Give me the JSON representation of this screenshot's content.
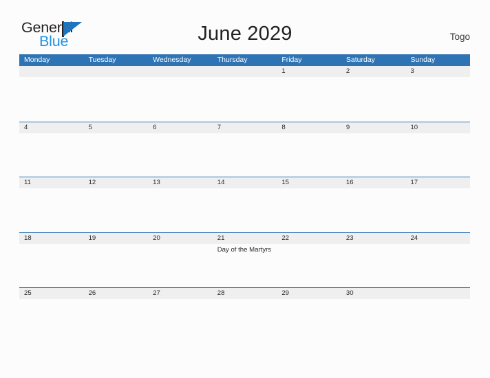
{
  "brand": {
    "name_part1": "General",
    "name_part2": "Blue",
    "flag_icon": "flag-triangle-icon",
    "colors": {
      "dark": "#231f20",
      "flag_blue": "#1f74bb",
      "text_blue": "#1f92e5"
    }
  },
  "header": {
    "title": "June 2029",
    "country": "Togo"
  },
  "calendar": {
    "accent_color": "#2e74b5",
    "band_color": "#efefef",
    "weekdays": [
      "Monday",
      "Tuesday",
      "Wednesday",
      "Thursday",
      "Friday",
      "Saturday",
      "Sunday"
    ],
    "weeks": [
      [
        {
          "day": "",
          "events": []
        },
        {
          "day": "",
          "events": []
        },
        {
          "day": "",
          "events": []
        },
        {
          "day": "",
          "events": []
        },
        {
          "day": "1",
          "events": []
        },
        {
          "day": "2",
          "events": []
        },
        {
          "day": "3",
          "events": []
        }
      ],
      [
        {
          "day": "4",
          "events": []
        },
        {
          "day": "5",
          "events": []
        },
        {
          "day": "6",
          "events": []
        },
        {
          "day": "7",
          "events": []
        },
        {
          "day": "8",
          "events": []
        },
        {
          "day": "9",
          "events": []
        },
        {
          "day": "10",
          "events": []
        }
      ],
      [
        {
          "day": "11",
          "events": []
        },
        {
          "day": "12",
          "events": []
        },
        {
          "day": "13",
          "events": []
        },
        {
          "day": "14",
          "events": []
        },
        {
          "day": "15",
          "events": []
        },
        {
          "day": "16",
          "events": []
        },
        {
          "day": "17",
          "events": []
        }
      ],
      [
        {
          "day": "18",
          "events": []
        },
        {
          "day": "19",
          "events": []
        },
        {
          "day": "20",
          "events": []
        },
        {
          "day": "21",
          "events": [
            "Day of the Martyrs"
          ]
        },
        {
          "day": "22",
          "events": []
        },
        {
          "day": "23",
          "events": []
        },
        {
          "day": "24",
          "events": []
        }
      ],
      [
        {
          "day": "25",
          "events": []
        },
        {
          "day": "26",
          "events": []
        },
        {
          "day": "27",
          "events": []
        },
        {
          "day": "28",
          "events": []
        },
        {
          "day": "29",
          "events": []
        },
        {
          "day": "30",
          "events": []
        },
        {
          "day": "",
          "events": []
        }
      ]
    ]
  }
}
